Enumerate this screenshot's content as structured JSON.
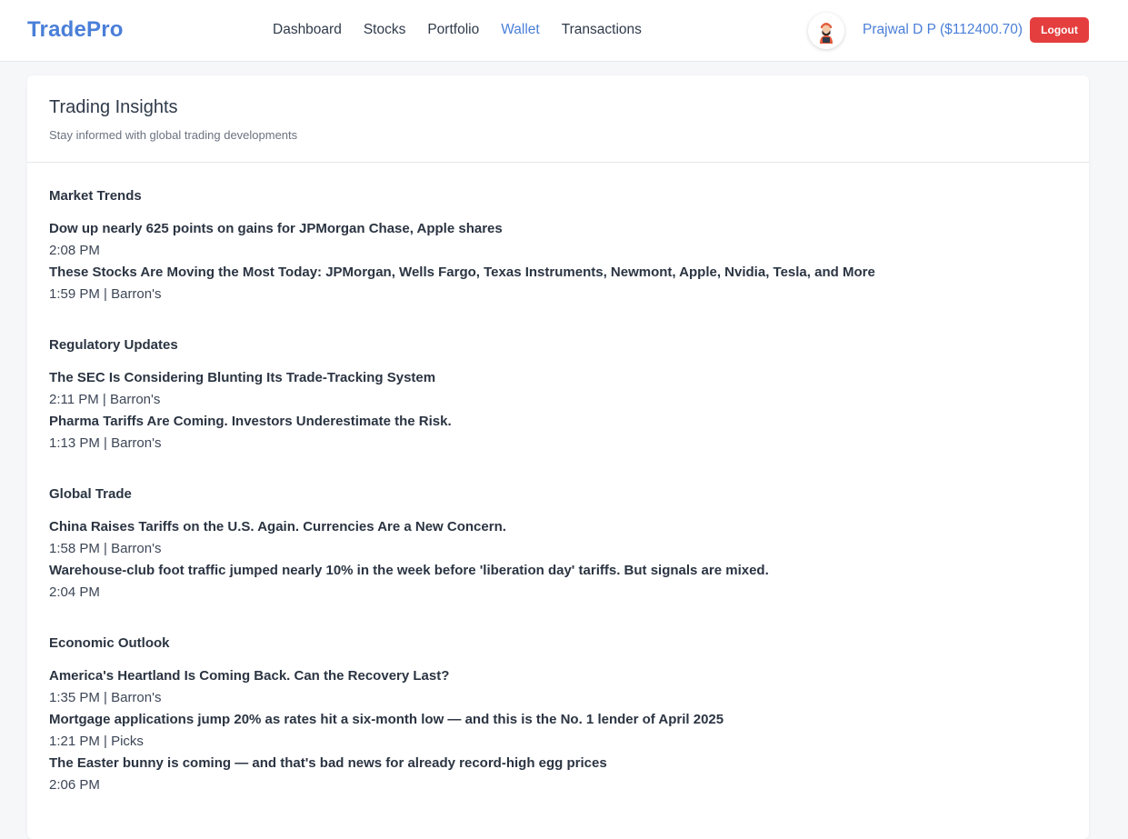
{
  "navbar": {
    "brand": "TradePro",
    "links": [
      "Dashboard",
      "Stocks",
      "Portfolio",
      "Wallet",
      "Transactions"
    ],
    "active_link": "Wallet",
    "user_label": "Prajwal D P ($112400.70)",
    "logout_label": "Logout",
    "accent_color": "#4a7fd8",
    "logout_color": "#e53e3e"
  },
  "card": {
    "title": "Trading Insights",
    "subtitle": "Stay informed with global trading developments"
  },
  "sections": [
    {
      "title": "Market Trends",
      "items": [
        {
          "headline": "Dow up nearly 625 points on gains for JPMorgan Chase, Apple shares",
          "meta": "2:08 PM"
        },
        {
          "headline": "These Stocks Are Moving the Most Today: JPMorgan, Wells Fargo, Texas Instruments, Newmont, Apple, Nvidia, Tesla, and More",
          "meta": "1:59 PM | Barron's"
        }
      ]
    },
    {
      "title": "Regulatory Updates",
      "items": [
        {
          "headline": "The SEC Is Considering Blunting Its Trade-Tracking System",
          "meta": "2:11 PM | Barron's"
        },
        {
          "headline": "Pharma Tariffs Are Coming. Investors Underestimate the Risk.",
          "meta": "1:13 PM | Barron's"
        }
      ]
    },
    {
      "title": "Global Trade",
      "items": [
        {
          "headline": "China Raises Tariffs on the U.S. Again. Currencies Are a New Concern.",
          "meta": "1:58 PM | Barron's"
        },
        {
          "headline": "Warehouse-club foot traffic jumped nearly 10% in the week before 'liberation day' tariffs. But signals are mixed.",
          "meta": "2:04 PM"
        }
      ]
    },
    {
      "title": "Economic Outlook",
      "items": [
        {
          "headline": "America's Heartland Is Coming Back. Can the Recovery Last?",
          "meta": "1:35 PM | Barron's"
        },
        {
          "headline": "Mortgage applications jump 20% as rates hit a six-month low — and this is the No. 1 lender of April 2025",
          "meta": "1:21 PM | Picks"
        },
        {
          "headline": "The Easter bunny is coming — and that's bad news for already record-high egg prices",
          "meta": "2:06 PM"
        }
      ]
    }
  ]
}
